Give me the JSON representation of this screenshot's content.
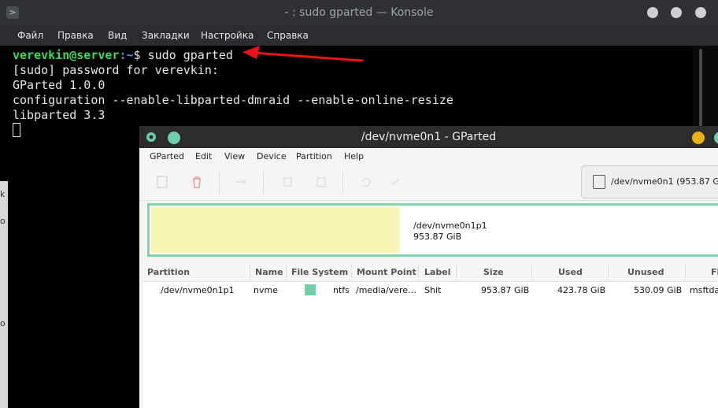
{
  "konsole": {
    "title": "- : sudo gparted — Konsole",
    "menu": [
      "Файл",
      "Правка",
      "Вид",
      "Закладки",
      "Настройка",
      "Справка"
    ],
    "prompt_user": "verevkin@server",
    "prompt_path": ":~",
    "prompt_cmd": "$ sudo gparted",
    "lines": [
      "[sudo] password for verevkin:",
      "GParted 1.0.0",
      "configuration --enable-libparted-dmraid --enable-online-resize",
      "libparted 3.3"
    ]
  },
  "background_strip": {
    "letters": [
      "k",
      "o",
      "o"
    ]
  },
  "gparted": {
    "title": "/dev/nvme0n1 - GParted",
    "menu": [
      "GParted",
      "Edit",
      "View",
      "Device",
      "Partition",
      "Help"
    ],
    "device_selector": "/dev/nvme0n1 (953.87 G",
    "map": {
      "name": "/dev/nvme0n1p1",
      "size": "953.87 GiB",
      "used_fraction": 0.44
    },
    "columns": [
      "Partition",
      "Name",
      "File System",
      "Mount Point",
      "Label",
      "Size",
      "Used",
      "Unused",
      "Fla"
    ],
    "rows": [
      {
        "partition": "/dev/nvme0n1p1",
        "name": "nvme",
        "filesystem": "ntfs",
        "mount_point": "/media/vere…",
        "label": "Shit",
        "size": "953.87 GiB",
        "used": "423.78 GiB",
        "unused": "530.09 GiB",
        "flags": "msftda"
      }
    ],
    "colors": {
      "ntfs": "#6fcfaa",
      "used": "#f7f7b5",
      "partition_border": "#7ed6a8",
      "close": "#e8b30f"
    }
  },
  "annotation": {
    "arrow_color": "#e8141b"
  }
}
